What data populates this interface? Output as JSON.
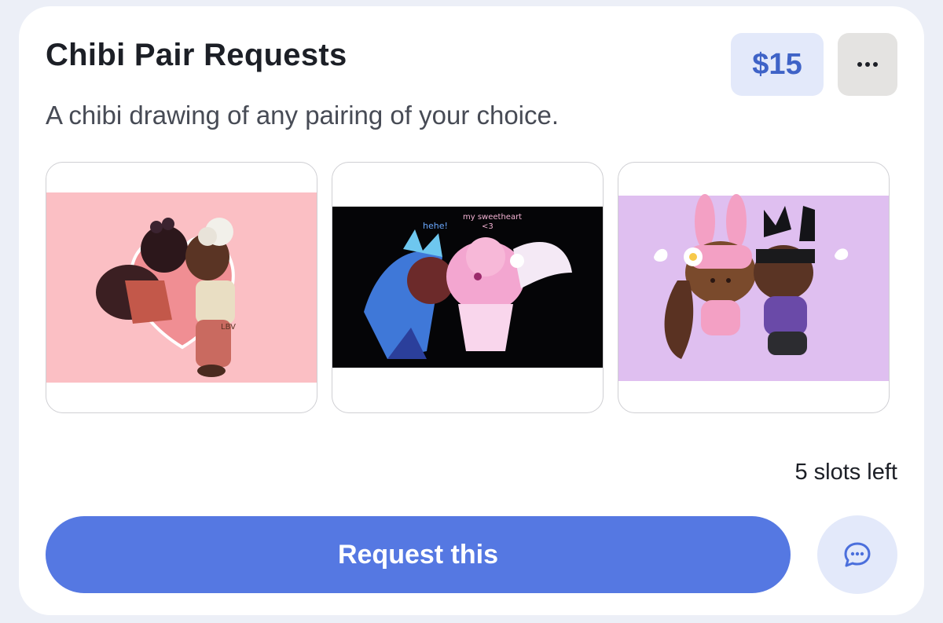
{
  "listing": {
    "title": "Chibi Pair Requests",
    "description": "A chibi drawing of any pairing of your choice.",
    "price": "$15",
    "slots_left": "5 slots left"
  },
  "actions": {
    "request_label": "Request this",
    "more_icon": "ellipsis-icon",
    "chat_icon": "chat-bubble-icon"
  },
  "gallery": {
    "images": [
      {
        "name": "chibi-couple-heart-kiss",
        "caption": "LBV"
      },
      {
        "name": "chibi-cookies-sweetheart",
        "caption_1": "hehe!",
        "caption_2": "my sweetheart",
        "caption_3": "<3"
      },
      {
        "name": "chibi-bunny-ears-pair",
        "caption": ""
      }
    ]
  },
  "colors": {
    "accent": "#5578e2",
    "price_text": "#3f63c7",
    "price_bg": "#e3e9fa",
    "card_bg": "#ffffff",
    "page_bg": "#eceff7"
  }
}
